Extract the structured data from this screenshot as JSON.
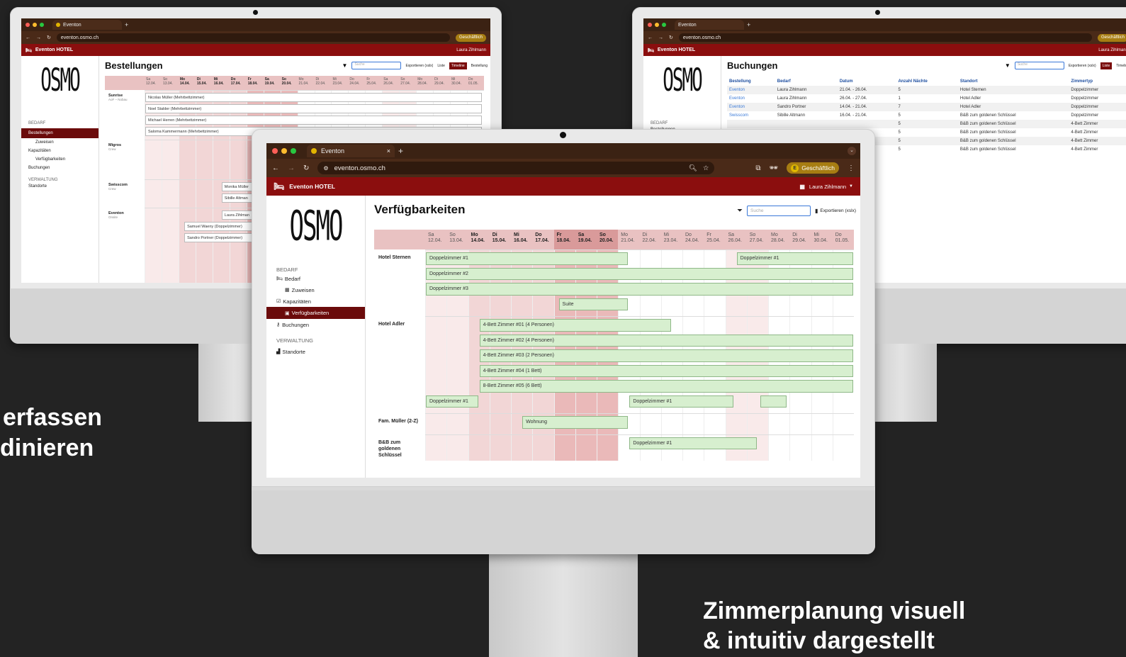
{
  "headline_left": [
    "erfassen",
    "dinieren"
  ],
  "headline_right": [
    "Zimmerplanung visuell",
    "& intuitiv dargestellt"
  ],
  "browser": {
    "tab_title": "Eventon",
    "tab_new": "+",
    "url": "eventon.osmo.ch",
    "profile_letter": "E",
    "profile_label": "Geschäftlich",
    "menu_glyph": "⋮"
  },
  "app": {
    "title": "Eventon HOTEL",
    "user": "Laura Zihlmann",
    "logo": "OSMO"
  },
  "colors": {
    "accent": "#8b0e0e",
    "active_nav": "#6b0b0b",
    "browser_dark": "#3b2213",
    "bar_green": "#d7efcf",
    "holiday": "#eab9b9"
  },
  "nav": {
    "section_bedarf": "BEDARF",
    "bedarf": "Bedarf",
    "zuweisen": "Zuweisen",
    "kapazitaeten": "Kapazitäten",
    "verfuegbarkeiten": "Verfügbarkeiten",
    "buchungen": "Buchungen",
    "section_verwaltung": "VERWALTUNG",
    "standorte": "Standorte",
    "bestellungen": "Bestellungen"
  },
  "toolbar": {
    "search_placeholder": "Suche",
    "export": "Exportieren (xslx)",
    "liste": "Liste",
    "timeline": "Timeline",
    "bestellung": "Bestellung"
  },
  "days": [
    {
      "d": "Sa",
      "n": "12.04."
    },
    {
      "d": "So",
      "n": "13.04."
    },
    {
      "d": "Mo",
      "n": "14.04."
    },
    {
      "d": "Di",
      "n": "15.04."
    },
    {
      "d": "Mi",
      "n": "16.04."
    },
    {
      "d": "Do",
      "n": "17.04."
    },
    {
      "d": "Fr",
      "n": "18.04."
    },
    {
      "d": "Sa",
      "n": "19.04."
    },
    {
      "d": "So",
      "n": "20.04."
    },
    {
      "d": "Mo",
      "n": "21.04."
    },
    {
      "d": "Di",
      "n": "22.04."
    },
    {
      "d": "Mi",
      "n": "23.04."
    },
    {
      "d": "Do",
      "n": "24.04."
    },
    {
      "d": "Fr",
      "n": "25.04."
    },
    {
      "d": "Sa",
      "n": "26.04."
    },
    {
      "d": "So",
      "n": "27.04."
    },
    {
      "d": "Mo",
      "n": "28.04."
    },
    {
      "d": "Di",
      "n": "29.04."
    },
    {
      "d": "Mi",
      "n": "30.04."
    },
    {
      "d": "Do",
      "n": "01.05."
    }
  ],
  "left_screen": {
    "title": "Bestellungen",
    "groups": [
      {
        "name": "Sunrise",
        "sub": "AoF – Nobau",
        "bars": [
          "Nicolas Müller (Mehrbettzimmer)",
          "Noel Stalder (Mehrbettzimmer)",
          "Michael Herren (Mehrbettzimmer)",
          "Saloma Kammermann (Mehrbettzimmer)"
        ]
      },
      {
        "name": "Migros",
        "sub": "Crew",
        "bars": []
      },
      {
        "name": "Swisscom",
        "sub": "Crew",
        "bars": [
          "Monika Müller",
          "Sibille Altman"
        ]
      },
      {
        "name": "Eventon",
        "sub": "Onsite",
        "bars": [
          "Laura Zihlman",
          "Samuel Waeny (Doppelzimmer)",
          "Sandro Portner (Doppelzimmer)"
        ]
      }
    ]
  },
  "right_screen": {
    "title": "Buchungen",
    "columns": [
      "Bestellung",
      "Bedarf",
      "Datum",
      "Anzahl Nächte",
      "Standort",
      "Zimmertyp"
    ],
    "rows": [
      [
        "Eventon",
        "Laura Zihlmann",
        "21.04. - 26.04.",
        "5",
        "Hotel Sternen",
        "Doppelzimmer"
      ],
      [
        "Eventon",
        "Laura Zihlmann",
        "26.04. - 27.04.",
        "1",
        "Hotel Adler",
        "Doppelzimmer"
      ],
      [
        "Eventon",
        "Sandro Portner",
        "14.04. - 21.04.",
        "7",
        "Hotel Adler",
        "Doppelzimmer"
      ],
      [
        "Swisscom",
        "Sibille Altmann",
        "16.04. - 21.04.",
        "5",
        "B&B zum goldenen Schlüssel",
        "Doppelzimmer"
      ],
      [
        "",
        "",
        "",
        "5",
        "B&B zum goldenen Schlüssel",
        "4-Bett Zimmer"
      ],
      [
        "",
        "",
        "",
        "5",
        "B&B zum goldenen Schlüssel",
        "4-Bett Zimmer"
      ],
      [
        "",
        "",
        "",
        "5",
        "B&B zum goldenen Schlüssel",
        "4-Bett Zimmer"
      ],
      [
        "",
        "",
        "",
        "5",
        "B&B zum goldenen Schlüssel",
        "4-Bett Zimmer"
      ]
    ]
  },
  "center_screen": {
    "title": "Verfügbarkeiten",
    "groups": [
      {
        "name": "Hotel Sternen",
        "bars": [
          {
            "label": "Doppelzimmer #1",
            "start": 0,
            "end": 9.5,
            "row": 0
          },
          {
            "label": "Doppelzimmer #1",
            "start": 14.5,
            "end": 20,
            "row": 0
          },
          {
            "label": "Doppelzimmer #2",
            "start": 0,
            "end": 20,
            "row": 1
          },
          {
            "label": "Doppelzimmer #3",
            "start": 0,
            "end": 20,
            "row": 2
          },
          {
            "label": "Suite",
            "start": 6.2,
            "end": 9.5,
            "row": 3
          }
        ],
        "rows": 4
      },
      {
        "name": "Hotel Adler",
        "bars": [
          {
            "label": "4-Bett Zimmer #01 (4 Personen)",
            "start": 2.5,
            "end": 11.5,
            "row": 0
          },
          {
            "label": "4-Bett Zimmer #02 (4 Personen)",
            "start": 2.5,
            "end": 20,
            "row": 1
          },
          {
            "label": "4-Bett Zimmer #03 (2 Personen)",
            "start": 2.5,
            "end": 20,
            "row": 2
          },
          {
            "label": "4-Bett Zimmer #04 (1 Bett)",
            "start": 2.5,
            "end": 20,
            "row": 3
          },
          {
            "label": "8-Bett Zimmer #05 (6 Bett)",
            "start": 2.5,
            "end": 20,
            "row": 4
          },
          {
            "label": "Doppelzimmer #1",
            "start": 0,
            "end": 2.5,
            "row": 5
          },
          {
            "label": "Doppelzimmer #1",
            "start": 9.5,
            "end": 14.4,
            "row": 5
          },
          {
            "label": "",
            "start": 15.6,
            "end": 16.9,
            "row": 5
          }
        ],
        "rows": 6
      },
      {
        "name": "Fam. Müller (2-Z)",
        "bars": [
          {
            "label": "Wohnung",
            "start": 4.5,
            "end": 9.5,
            "row": 0
          }
        ],
        "rows": 1
      },
      {
        "name": "B&B zum goldenen Schlüssel",
        "bars": [
          {
            "label": "Doppelzimmer #1",
            "start": 9.5,
            "end": 15.5,
            "row": 0
          }
        ],
        "rows": 1.5
      }
    ]
  }
}
